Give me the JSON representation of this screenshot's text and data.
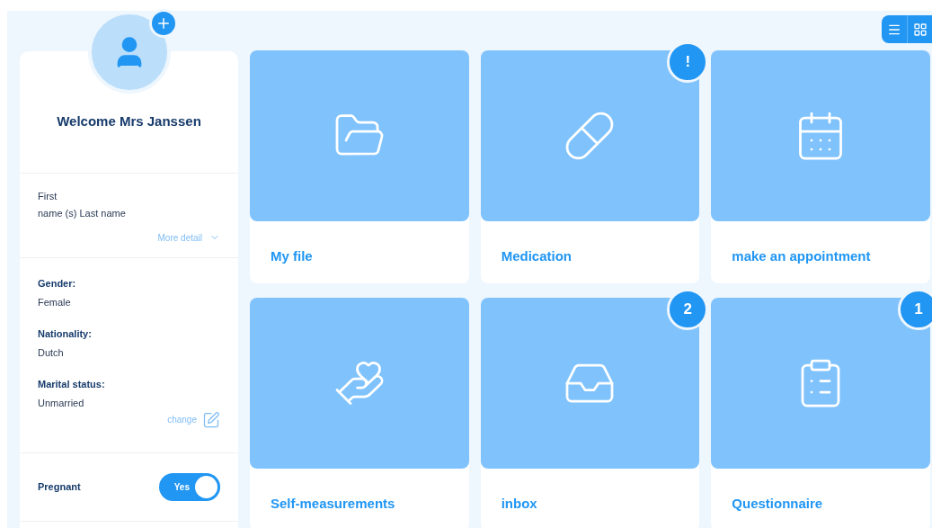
{
  "view_toggle": [
    {
      "kind": "list"
    },
    {
      "kind": "grid"
    }
  ],
  "sidebar": {
    "welcome": "Welcome Mrs Janssen",
    "name_lines": [
      "First",
      "name (s) Last name"
    ],
    "more_detail": "More detail",
    "details": [
      {
        "label": "Gender:",
        "value": "Female"
      },
      {
        "label": "Nationality:",
        "value": "Dutch"
      },
      {
        "label": "Marital status:",
        "value": "Unmarried"
      }
    ],
    "change_link": "change",
    "pregnant": {
      "label": "Pregnant",
      "on": true,
      "toggle_text": "Yes"
    }
  },
  "tiles": [
    {
      "kind": "file",
      "title": "My file"
    },
    {
      "kind": "medication",
      "title": "Medication",
      "badge": "!"
    },
    {
      "kind": "appointment",
      "title": "make an appointment"
    },
    {
      "kind": "measurements",
      "title": "Self-measurements"
    },
    {
      "kind": "inbox",
      "title": "inbox",
      "badge": "2"
    },
    {
      "kind": "questionnaire",
      "title": "Questionnaire",
      "badge": "1"
    }
  ]
}
